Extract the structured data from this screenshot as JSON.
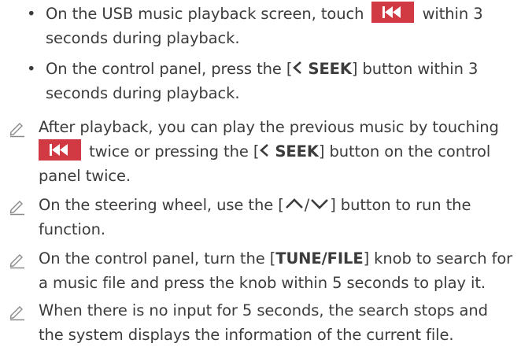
{
  "bullets": [
    {
      "before": "On the USB music playback screen, touch",
      "after": "within 3 seconds during playback."
    },
    {
      "before": "On the control panel, press the [",
      "button_label": "SEEK",
      "after": "] button within 3 seconds during playback."
    }
  ],
  "notes": [
    {
      "line1": "After playback, you can play the previous music by touching",
      "mid_before": "twice or pressing the [",
      "button_label": "SEEK",
      "mid_after": "] button on the control",
      "line3": "panel twice."
    },
    {
      "before": "On the steering wheel, use the [",
      "slash": "/",
      "after": "] button to run the function."
    },
    {
      "before": "On the control panel, turn the [",
      "knob_label": "TUNE/FILE",
      "after": "] knob to search for a music file and press the knob within 5 seconds to play it."
    },
    {
      "text": "When there is no input for 5 seconds, the search stops and the system displays the information of the current file."
    }
  ],
  "icons": {
    "bullet": "bullet-dot",
    "note": "pencil-note-icon",
    "previous_track": "previous-track-icon",
    "seek_back": "chevron-left-icon",
    "up": "chevron-up-icon",
    "down": "chevron-down-icon"
  },
  "colors": {
    "text": "#3c3c3c",
    "accent": "#d13a43",
    "note_icon": "#8a8a8a"
  }
}
